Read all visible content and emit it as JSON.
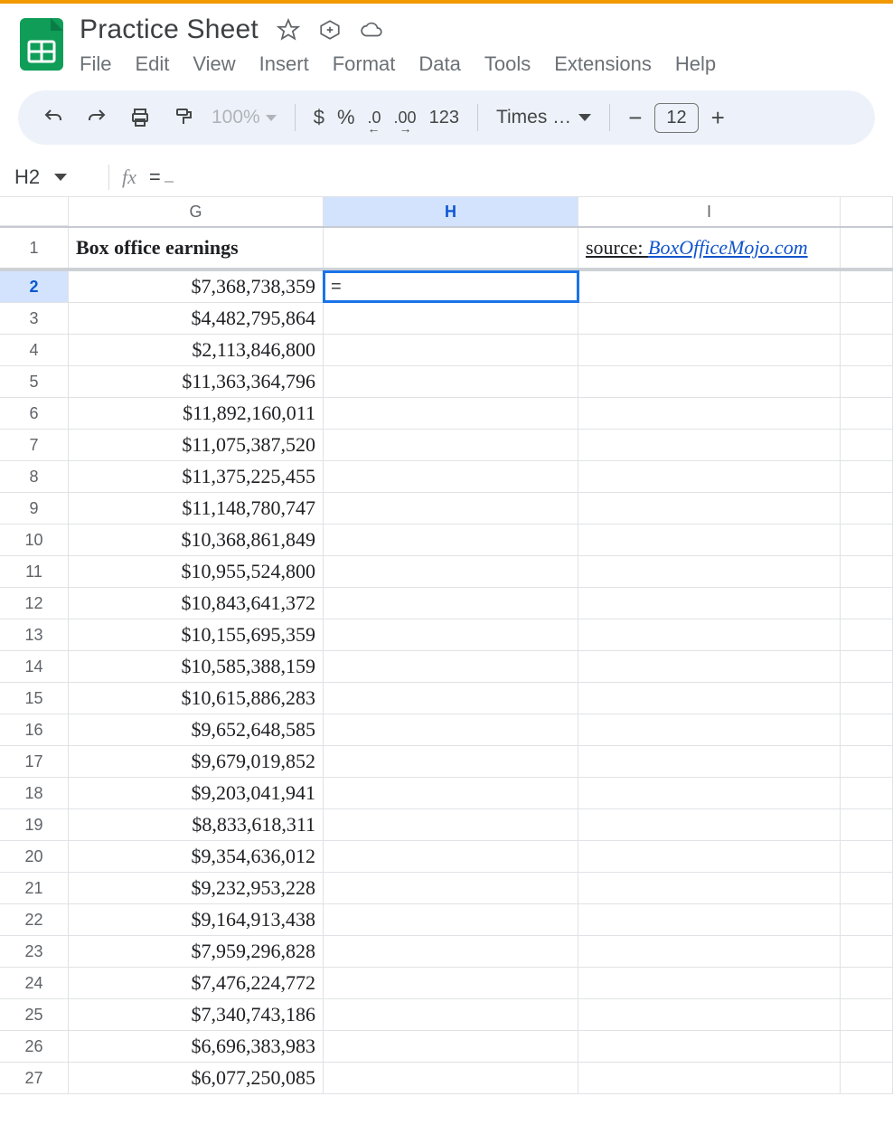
{
  "app": {
    "title": "Practice Sheet",
    "starred": false
  },
  "menubar": [
    "File",
    "Edit",
    "View",
    "Insert",
    "Format",
    "Data",
    "Tools",
    "Extensions",
    "Help"
  ],
  "toolbar": {
    "zoom": "100%",
    "currency": "$",
    "percent": "%",
    "dec_less": ".0",
    "dec_more": ".00",
    "numfmt": "123",
    "font_name": "Times …",
    "minus": "−",
    "font_size": "12",
    "plus": "+"
  },
  "namebox": {
    "ref": "H2"
  },
  "formula_bar": {
    "fx_label": "fx",
    "value": "="
  },
  "columns": [
    "G",
    "H",
    "I",
    ""
  ],
  "active": {
    "col": "H",
    "row": 2,
    "value": "="
  },
  "header_row": {
    "G": "Box office earnings",
    "I_prefix": "source:  ",
    "I_link": "BoxOfficeMojo.com"
  },
  "rows": [
    "$7,368,738,359",
    "$4,482,795,864",
    "$2,113,846,800",
    "$11,363,364,796",
    "$11,892,160,011",
    "$11,075,387,520",
    "$11,375,225,455",
    "$11,148,780,747",
    "$10,368,861,849",
    "$10,955,524,800",
    "$10,843,641,372",
    "$10,155,695,359",
    "$10,585,388,159",
    "$10,615,886,283",
    "$9,652,648,585",
    "$9,679,019,852",
    "$9,203,041,941",
    "$8,833,618,311",
    "$9,354,636,012",
    "$9,232,953,228",
    "$9,164,913,438",
    "$7,959,296,828",
    "$7,476,224,772",
    "$7,340,743,186",
    "$6,696,383,983",
    "$6,077,250,085"
  ]
}
